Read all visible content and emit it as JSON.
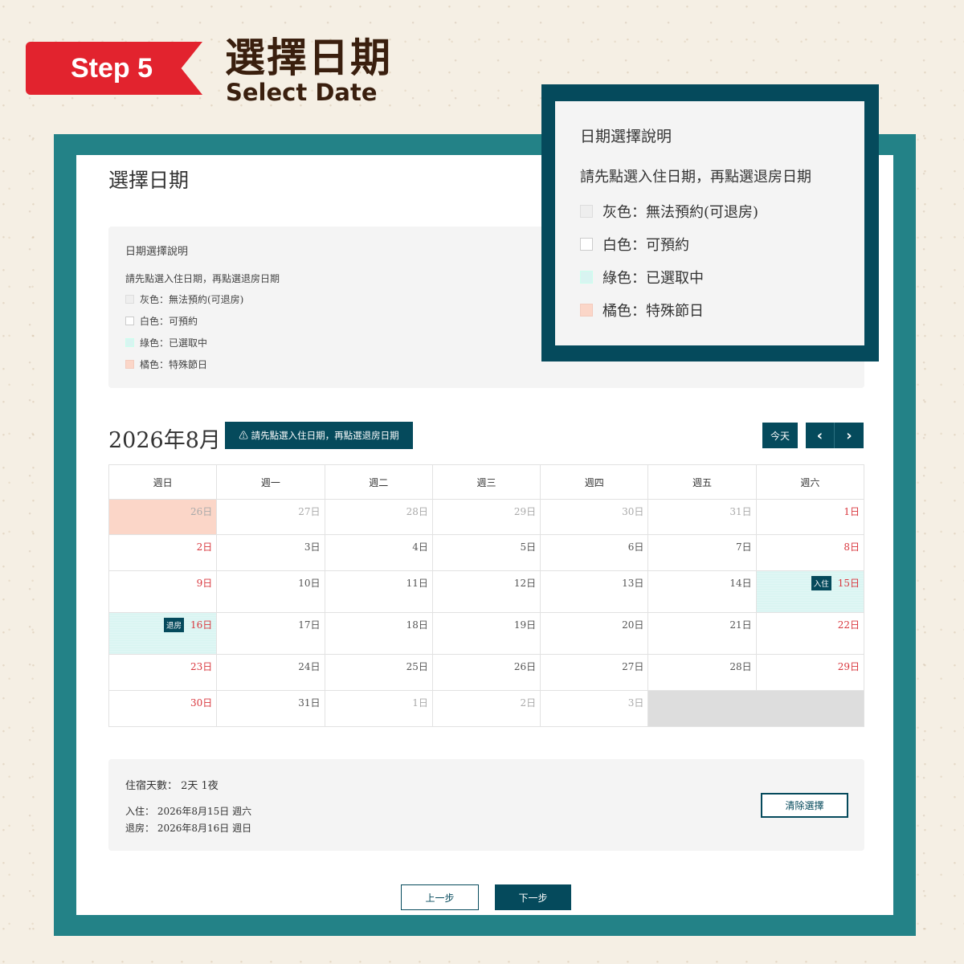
{
  "header": {
    "step": "Step 5",
    "title_zh": "選擇日期",
    "title_en": "Select Date"
  },
  "panel": {
    "title": "選擇日期"
  },
  "legend": {
    "title": "日期選擇說明",
    "desc": "請先點選入住日期，再點選退房日期",
    "items": [
      "灰色：無法預約(可退房)",
      "白色：可預約",
      "綠色：已選取中",
      "橘色：特殊節日"
    ]
  },
  "callout": {
    "title": "日期選擇說明",
    "desc": "請先點選入住日期，再點選退房日期",
    "items": [
      "灰色：無法預約(可退房)",
      "白色：可預約",
      "綠色：已選取中",
      "橘色：特殊節日"
    ]
  },
  "calendar": {
    "month": "2026年8月",
    "hint": "⚠ 請先點選入住日期，再點選退房日期",
    "today": "今天",
    "prev_icon": "chevron-left-icon",
    "next_icon": "chevron-right-icon",
    "weekdays": [
      "週日",
      "週一",
      "週二",
      "週三",
      "週四",
      "週五",
      "週六"
    ],
    "checkin_tag": "入住",
    "checkout_tag": "退房",
    "weeks": [
      [
        "26日",
        "27日",
        "28日",
        "29日",
        "30日",
        "31日",
        "1日"
      ],
      [
        "2日",
        "3日",
        "4日",
        "5日",
        "6日",
        "7日",
        "8日"
      ],
      [
        "9日",
        "10日",
        "11日",
        "12日",
        "13日",
        "14日",
        "15日"
      ],
      [
        "16日",
        "17日",
        "18日",
        "19日",
        "20日",
        "21日",
        "22日"
      ],
      [
        "23日",
        "24日",
        "25日",
        "26日",
        "27日",
        "28日",
        "29日"
      ],
      [
        "30日",
        "31日",
        "1日",
        "2日",
        "3日",
        "",
        ""
      ]
    ]
  },
  "summary": {
    "nights": "住宿天數： 2天 1夜",
    "checkin": "入住： 2026年8月15日 週六",
    "checkout": "退房： 2026年8月16日 週日",
    "clear": "清除選擇"
  },
  "footer": {
    "back": "上一步",
    "next": "下一步"
  },
  "colors": {
    "brand_red": "#e2232e",
    "teal_frame": "#238287",
    "navy": "#054a5c",
    "selected": "#d8f4f1",
    "holiday": "#fbd6c8",
    "weekend_text": "#d9383f"
  }
}
